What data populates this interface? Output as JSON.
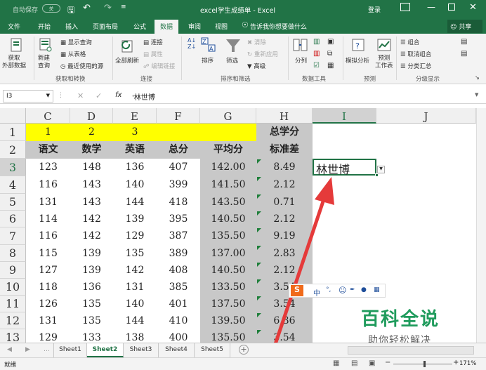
{
  "titlebar": {
    "autosave": "自动保存",
    "autosave_state": "关",
    "title": "excel学生成绩单 - Excel",
    "login": "登录"
  },
  "tabs": [
    {
      "label": "文件"
    },
    {
      "label": "开始"
    },
    {
      "label": "插入"
    },
    {
      "label": "页面布局"
    },
    {
      "label": "公式"
    },
    {
      "label": "数据"
    },
    {
      "label": "审阅"
    },
    {
      "label": "视图"
    }
  ],
  "tellme": "告诉我你想要做什么",
  "share": "共享",
  "ribbon": {
    "get_data": "获取\n外部数据",
    "new_query": "新建\n查询",
    "show_query": "显示查询",
    "from_table": "从表格",
    "recent_sources": "最近使用的源",
    "group_get": "获取和转换",
    "refresh_all": "全部刷新",
    "connections": "连接",
    "properties": "属性",
    "edit_links": "编辑链接",
    "group_conn": "连接",
    "sort": "排序",
    "filter": "筛选",
    "clear": "清除",
    "reapply": "重新应用",
    "advanced": "高级",
    "group_sort": "排序和筛选",
    "text_to_col": "分列",
    "group_tools": "数据工具",
    "whatif": "模拟分析",
    "forecast": "预测\n工作表",
    "group_forecast": "预测",
    "group": "组合",
    "ungroup": "取消组合",
    "subtotal": "分类汇总",
    "group_outline": "分级显示"
  },
  "namebox": "I3",
  "fx": "fx",
  "formula": "'林世博",
  "columns": [
    "C",
    "D",
    "E",
    "F",
    "G",
    "H",
    "I",
    "J"
  ],
  "rows": [
    "1",
    "2",
    "3",
    "4",
    "5",
    "6",
    "7",
    "8",
    "9",
    "10",
    "11",
    "12",
    "13"
  ],
  "row1": [
    "1",
    "2",
    "3",
    "",
    "",
    "总学分"
  ],
  "row2": [
    "语文",
    "数学",
    "英语",
    "总分",
    "平均分",
    "标准差"
  ],
  "data": [
    [
      "123",
      "148",
      "136",
      "407",
      "142.00",
      "8.49"
    ],
    [
      "116",
      "143",
      "140",
      "399",
      "141.50",
      "2.12"
    ],
    [
      "131",
      "143",
      "144",
      "418",
      "143.50",
      "0.71"
    ],
    [
      "114",
      "142",
      "139",
      "395",
      "140.50",
      "2.12"
    ],
    [
      "116",
      "142",
      "129",
      "387",
      "135.50",
      "9.19"
    ],
    [
      "115",
      "139",
      "135",
      "389",
      "137.00",
      "2.83"
    ],
    [
      "127",
      "139",
      "142",
      "408",
      "140.50",
      "2.12"
    ],
    [
      "118",
      "136",
      "131",
      "385",
      "133.50",
      "3.54"
    ],
    [
      "126",
      "135",
      "140",
      "401",
      "137.50",
      "3.54"
    ],
    [
      "131",
      "135",
      "144",
      "410",
      "139.50",
      "6.36"
    ],
    [
      "129",
      "133",
      "138",
      "400",
      "135.50",
      "3.54"
    ]
  ],
  "active_cell_value": "林世博",
  "sheets": [
    {
      "label": "Sheet1"
    },
    {
      "label": "Sheet2"
    },
    {
      "label": "Sheet3"
    },
    {
      "label": "Sheet4"
    },
    {
      "label": "Sheet5"
    }
  ],
  "status": {
    "ready": "就绪",
    "zoom": "171%"
  },
  "ime": {
    "lang": "中"
  },
  "watermark": {
    "title": "百科全说",
    "subtitle": "助你轻松解决"
  },
  "colors": {
    "excel_green": "#217346",
    "highlight_yellow": "#ffff00",
    "gray_fill": "#c8c8c8",
    "arrow_red": "#e53a3a"
  }
}
